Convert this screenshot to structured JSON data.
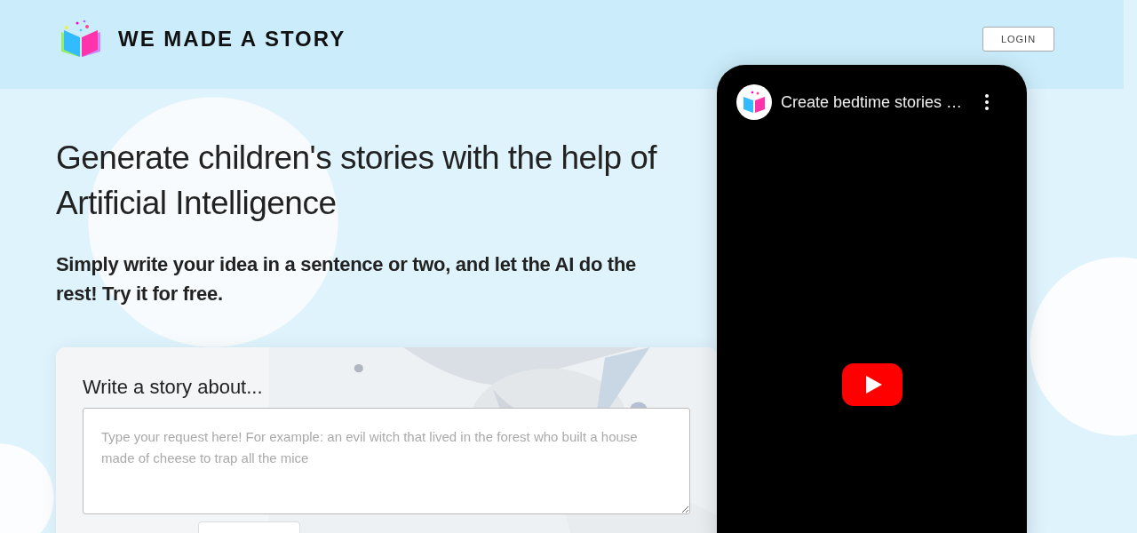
{
  "header": {
    "logo_text": "WE MADE A STORY",
    "login_button": "LOGIN"
  },
  "hero": {
    "title": "Generate children's stories with the help of Artificial Intelligence",
    "subtitle": "Simply write your idea in a sentence or two, and let the AI do the rest! Try it for free."
  },
  "story_form": {
    "heading": "Write a story about...",
    "request_field": {
      "placeholder": "Type your request here! For example: an evil witch that lived in the forest who built a house made of cheese to trap all the mice"
    }
  },
  "video": {
    "title": "Create bedtime stories …"
  }
}
